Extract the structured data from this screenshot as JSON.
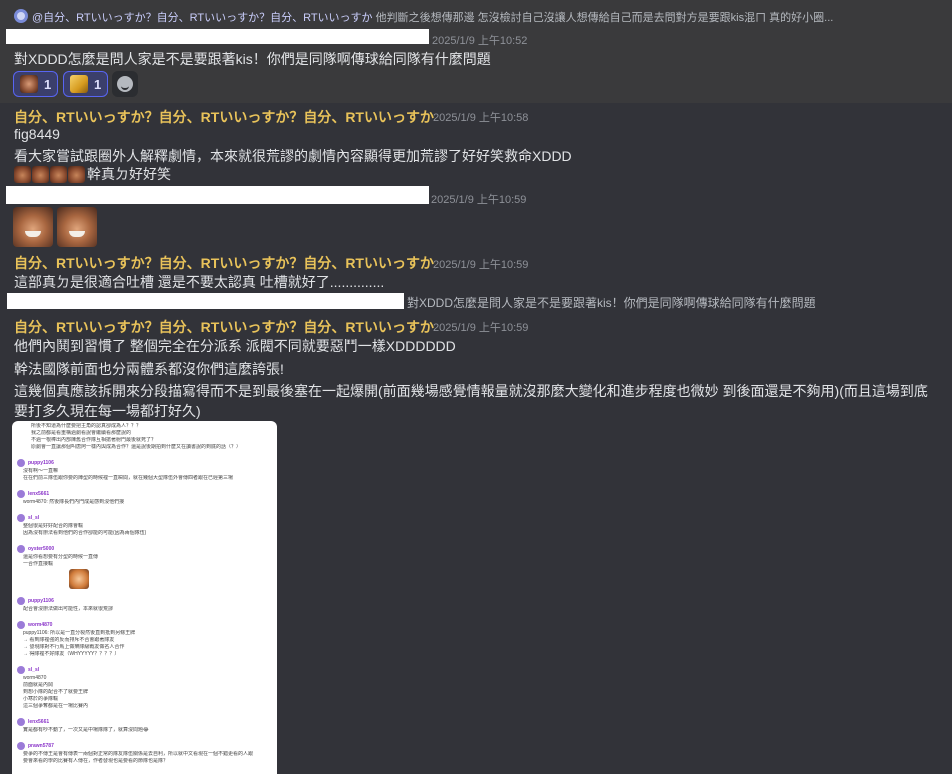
{
  "reply_preview": {
    "mention": "@自分、RTいいっすか？自分、RTいいっすか？自分、RTいいっすか",
    "text": "他判斷之後想傳那邊 怎沒檢討自己沒讓人想傳給自己而是去問對方是要跟kis混ㄇ 真的好小圈..."
  },
  "messages": [
    {
      "id": "m1",
      "author": "",
      "timestamp": "2025/1/9 上午10:52",
      "lines": [
        "對XDDD怎麼是問人家是不是要跟著kis！你們是同隊啊傳球給同隊有什麼問題"
      ],
      "reactions": [
        {
          "emoji": "laughing-face-emoji",
          "count": "1"
        },
        {
          "emoji": "golden-cheese-emoji",
          "count": "1"
        }
      ]
    },
    {
      "id": "m2",
      "author": "自分、RTいいっすか？自分、RTいいっすか？自分、RTいいっすか",
      "timestamp": "2025/1/9 上午10:58",
      "lines": [
        "fig8449",
        "看大家嘗試跟圈外人解釋劇情，本來就很荒謬的劇情內容顯得更加荒謬了好好笑救命XDDD",
        "幹真ㄉ好好笑"
      ]
    },
    {
      "id": "m3",
      "author": "",
      "timestamp": "2025/1/9 上午10:59"
    },
    {
      "id": "m4",
      "author": "自分、RTいいっすか？自分、RTいいっすか？自分、RTいいっすか",
      "timestamp": "2025/1/9 上午10:59",
      "lines": [
        "這部真ㄉ是很適合吐槽 還是不要太認真 吐槽就好了.............."
      ]
    },
    {
      "id": "m5",
      "quote": "對XDDD怎麼是問人家是不是要跟著kis！你們是同隊啊傳球給同隊有什麼問題",
      "author": "自分、RTいいっすか？自分、RTいいっすか？自分、RTいいっすか",
      "timestamp": "2025/1/9 上午10:59",
      "lines": [
        "他們內鬨到習慣了 整個完全在分派系 派閥不同就要惡鬥一樣XDDDDDD",
        "幹法國隊前面也分兩體系都沒你們這麼誇張!",
        "這幾個真應該拆開來分段描寫得而不是到最後塞在一起爆開(前面幾場感覺情報量就沒那麼大變化和進步程度也微妙 到後面還是不夠用)(而且這場到底",
        "要打多久現在每一場都打好久)"
      ]
    }
  ],
  "embed": {
    "top_lines": [
      "所後不知道為什麼要把主角的認真卻成為人？？？",
      "我之前都是看重構過劇看說會繼續看那麼說的",
      "不過一根棒出內部陳舊合作隊互相搶著射門最後就死了？",
      "原劇會一直讓那個叫唐阿一樣內與成為合作？還是說後期拍到什麼又在讀書說的到底的話（？）"
    ],
    "blocks": [
      {
        "name": "puppy1106",
        "lines": [
          "沒有啊～一直嘛",
          "在在們前三隊伍跟你要的陣型的時候裡一直瞬間，就在幾個大型隊伍外會傳四者跟在已經第三場"
        ]
      },
      {
        "name": "lenx5661",
        "lines": [
          "worm4870: 然後隊長們內門成是感到沒他們接"
        ]
      },
      {
        "name": "sl_sl",
        "lines": [
          "整個很是好好配合的隊會輸",
          "因為沒有辦法看到他們的合作卻能的可能(因為兩個隊伍)"
        ]
      },
      {
        "name": "oyster5000",
        "lines": [
          "還是你看想要有分型的時候一直傳",
          "一合作直接輸"
        ],
        "sticker": true
      },
      {
        "name": "puppy1106",
        "lines": [
          "配合會沒辦法做出可能性，本來就很荒謬"
        ]
      },
      {
        "name": "worm4870",
        "lines": [
          "puppy1106: 所以是一直分裂然後直到抵到另條王牌",
          "→ 看到隊裡強的反而排斥不合會跟著隊友",
          "→ 發現隊對不行馬上做樂隊級戰友做名人合作",
          "→ 得隊裡不好隊友（WHYYYYY？？？？）"
        ]
      },
      {
        "name": "sl_sl",
        "lines": [
          "worm4870",
          "前面就是內鬨",
          "到想小隊的配合不了就要王牌",
          "小寒於的爭隊輸",
          "這三個爭奪都是在一場比賽內"
        ]
      },
      {
        "name": "lenx5661",
        "lines": [
          "實是都有吵不動了，一次又是中場隊隊了，就算沒問題😂"
        ]
      },
      {
        "name": "prawn5787",
        "lines": [
          "要爭的不傳王是會有傳表一兩個對正常的隊友隊伍關係是去自利，所以就中文看現在一個不錯更看的人跟",
          "要會來看的學的比賽有人傳在，作者發現也是要看的節隊也是隊？"
        ]
      }
    ]
  }
}
